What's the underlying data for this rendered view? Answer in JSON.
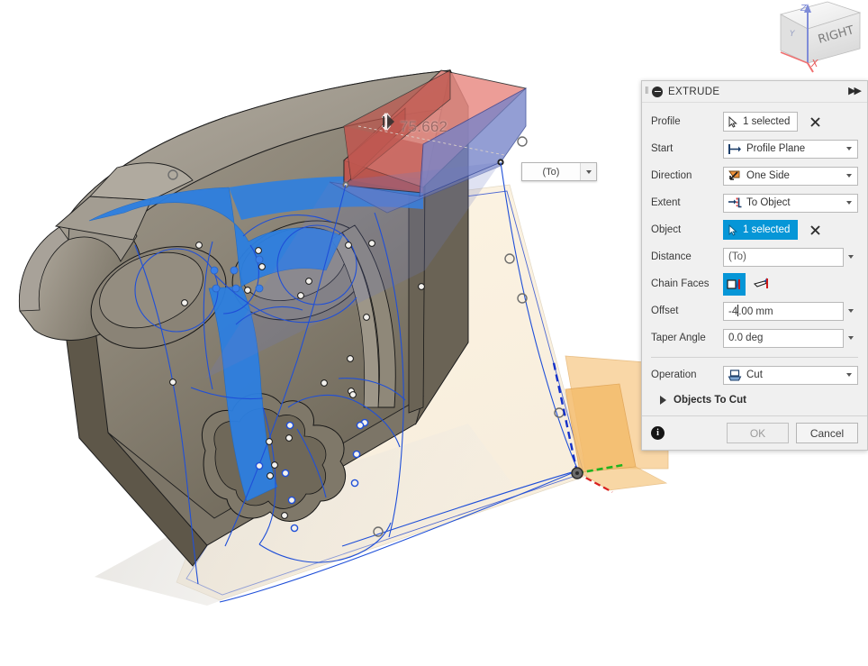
{
  "viewcube": {
    "face_label": "RIGHT",
    "axis_x_label": "X",
    "axis_y_label": "Y",
    "axis_z_label": "Z",
    "axis_x_color": "#f06a6a",
    "axis_y_color": "#9aa7c9",
    "axis_z_color": "#6e7fd4"
  },
  "canvas": {
    "dimension_label": "75.662",
    "floating_distance_value": "(To)"
  },
  "dialog": {
    "title": "EXTRUDE",
    "collapse_icon": "collapse-circle-icon",
    "expand_icon": "chevron-double-right-icon",
    "rows": {
      "profile": {
        "label": "Profile",
        "button_text": "1 selected",
        "selected": false
      },
      "start": {
        "label": "Start",
        "value": "Profile Plane",
        "icon": "profile-plane-icon"
      },
      "direction": {
        "label": "Direction",
        "value": "One Side",
        "icon": "one-side-icon"
      },
      "extent": {
        "label": "Extent",
        "value": "To Object",
        "icon": "to-object-icon"
      },
      "object": {
        "label": "Object",
        "button_text": "1 selected",
        "selected": true
      },
      "distance": {
        "label": "Distance",
        "value": "(To)"
      },
      "chain_faces": {
        "label": "Chain Faces",
        "option_on_name": "chain-faces-on-icon",
        "option_off_name": "chain-faces-off-icon",
        "active_index": 0
      },
      "offset": {
        "label": "Offset",
        "value_before_caret": "-4",
        "value_after_caret": ".00 mm"
      },
      "taper_angle": {
        "label": "Taper Angle",
        "value": "0.0 deg"
      },
      "operation": {
        "label": "Operation",
        "value": "Cut",
        "icon": "cut-operation-icon"
      },
      "objects_to_cut": {
        "label": "Objects To Cut",
        "expanded": false
      }
    },
    "footer": {
      "info_glyph": "i",
      "ok_label": "OK",
      "cancel_label": "Cancel"
    }
  },
  "colors": {
    "accent_blue": "#0696d7",
    "panel_bg": "#f0f0f0",
    "body_gray": "#8b8478",
    "highlight_blue_face": "#2d7fe0",
    "preview_red": "#c45a52",
    "preview_blue": "#6f7fc4",
    "sketch_blue": "#1f4fd8",
    "construction_plane": "#f4c98a"
  }
}
